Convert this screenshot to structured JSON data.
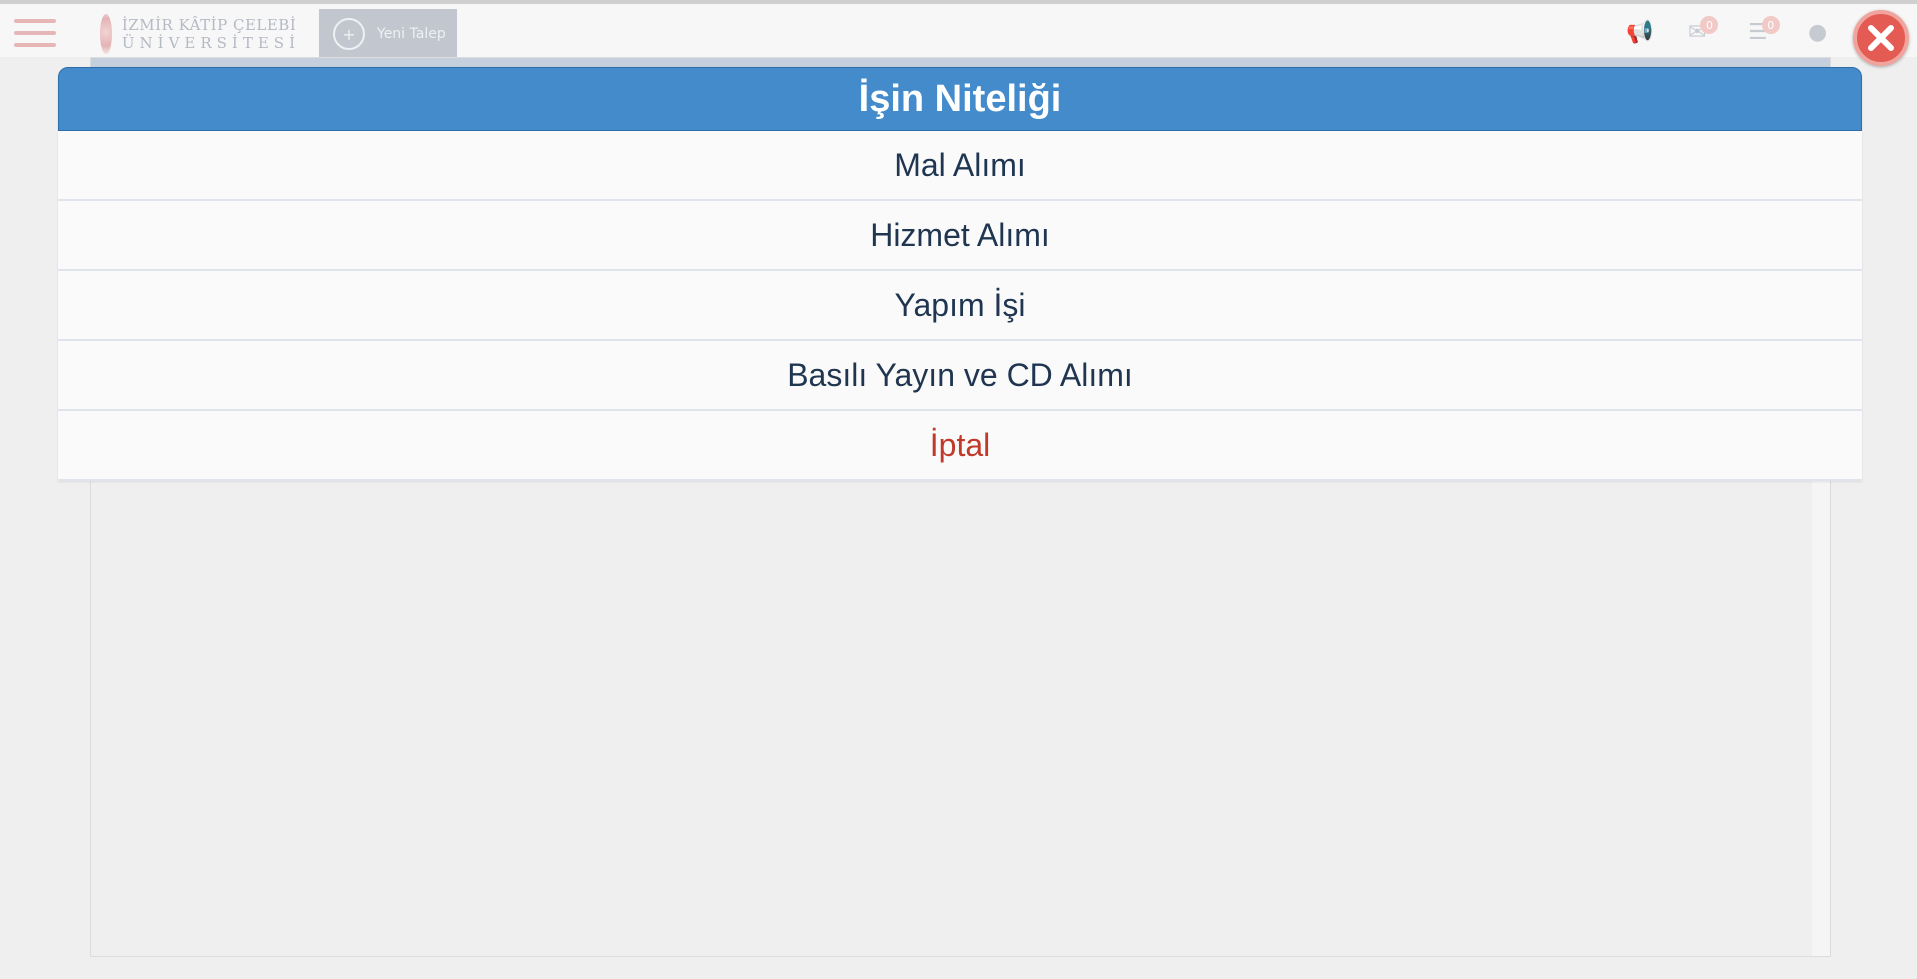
{
  "header": {
    "logo_line1": "İZMİR KÂTİP ÇELEBİ",
    "logo_line2": "ÜNİVERSİTESİ",
    "new_request_label": "Yeni Talep",
    "mail_count": "0",
    "tasks_count": "0"
  },
  "modal": {
    "title": "İşin Niteliği",
    "options": [
      {
        "label": "Mal Alımı"
      },
      {
        "label": "Hizmet Alımı"
      },
      {
        "label": "Yapım İşi"
      },
      {
        "label": "Basılı Yayın ve CD Alımı"
      }
    ],
    "cancel_label": "İptal"
  },
  "colors": {
    "modal_header": "#438bcb",
    "cancel_text": "#c0392b",
    "option_text": "#1f3550",
    "close_button": "#e35b52"
  },
  "icons": [
    "menu-icon",
    "plus-icon",
    "megaphone-icon",
    "mail-icon",
    "list-icon",
    "globe-icon",
    "close-icon"
  ]
}
